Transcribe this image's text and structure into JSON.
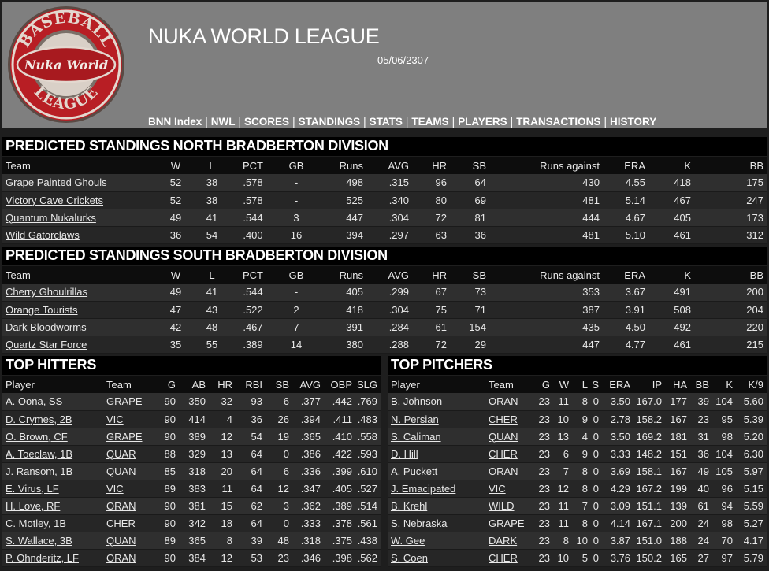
{
  "header": {
    "title": "NUKA WORLD LEAGUE",
    "date": "05/06/2307",
    "logo": {
      "top_text": "BASEBALL",
      "center_text": "Nuka World",
      "bottom_text": "LEAGUE",
      "colors": {
        "outer": "#b81e24",
        "inner": "#a81a1f",
        "ring": "#7a7068",
        "center": "#d9d0c7"
      }
    }
  },
  "nav": [
    {
      "label": "BNN Index"
    },
    {
      "label": "NWL"
    },
    {
      "label": "SCORES"
    },
    {
      "label": "STANDINGS"
    },
    {
      "label": "STATS"
    },
    {
      "label": "TEAMS"
    },
    {
      "label": "PLAYERS"
    },
    {
      "label": "TRANSACTIONS"
    },
    {
      "label": "HISTORY"
    }
  ],
  "north": {
    "title": "PREDICTED STANDINGS NORTH BRADBERTON DIVISION",
    "headers": [
      "Team",
      "W",
      "L",
      "PCT",
      "GB",
      "Runs",
      "AVG",
      "HR",
      "SB",
      "Runs against",
      "ERA",
      "K",
      "BB"
    ],
    "rows": [
      [
        "Grape Painted Ghouls",
        "52",
        "38",
        ".578",
        "-",
        "498",
        ".315",
        "96",
        "64",
        "430",
        "4.55",
        "418",
        "175"
      ],
      [
        "Victory Cave Crickets",
        "52",
        "38",
        ".578",
        "-",
        "525",
        ".340",
        "80",
        "69",
        "481",
        "5.14",
        "467",
        "247"
      ],
      [
        "Quantum Nukalurks",
        "49",
        "41",
        ".544",
        "3",
        "447",
        ".304",
        "72",
        "81",
        "444",
        "4.67",
        "405",
        "173"
      ],
      [
        "Wild Gatorclaws",
        "36",
        "54",
        ".400",
        "16",
        "394",
        ".297",
        "63",
        "36",
        "481",
        "5.10",
        "461",
        "312"
      ]
    ]
  },
  "south": {
    "title": "PREDICTED STANDINGS SOUTH BRADBERTON DIVISION",
    "headers": [
      "Team",
      "W",
      "L",
      "PCT",
      "GB",
      "Runs",
      "AVG",
      "HR",
      "SB",
      "Runs against",
      "ERA",
      "K",
      "BB"
    ],
    "rows": [
      [
        "Cherry Ghoulrillas",
        "49",
        "41",
        ".544",
        "-",
        "405",
        ".299",
        "67",
        "73",
        "353",
        "3.67",
        "491",
        "200"
      ],
      [
        "Orange Tourists",
        "47",
        "43",
        ".522",
        "2",
        "418",
        ".304",
        "75",
        "71",
        "387",
        "3.91",
        "508",
        "204"
      ],
      [
        "Dark Bloodworms",
        "42",
        "48",
        ".467",
        "7",
        "391",
        ".284",
        "61",
        "154",
        "435",
        "4.50",
        "492",
        "220"
      ],
      [
        "Quartz Star Force",
        "35",
        "55",
        ".389",
        "14",
        "380",
        ".288",
        "72",
        "29",
        "447",
        "4.77",
        "461",
        "215"
      ]
    ]
  },
  "hitters": {
    "title": "TOP HITTERS",
    "headers": [
      "Player",
      "Team",
      "G",
      "AB",
      "HR",
      "RBI",
      "SB",
      "AVG",
      "OBP",
      "SLG"
    ],
    "rows": [
      [
        "A. Oona, SS",
        "GRAPE",
        "90",
        "350",
        "32",
        "93",
        "6",
        ".377",
        ".442",
        ".769"
      ],
      [
        "D. Crymes, 2B",
        "VIC",
        "90",
        "414",
        "4",
        "36",
        "26",
        ".394",
        ".411",
        ".483"
      ],
      [
        "O. Brown, CF",
        "GRAPE",
        "90",
        "389",
        "12",
        "54",
        "19",
        ".365",
        ".410",
        ".558"
      ],
      [
        "A. Toeclaw, 1B",
        "QUAR",
        "88",
        "329",
        "13",
        "64",
        "0",
        ".386",
        ".422",
        ".593"
      ],
      [
        "J. Ransom, 1B",
        "QUAN",
        "85",
        "318",
        "20",
        "64",
        "6",
        ".336",
        ".399",
        ".610"
      ],
      [
        "E. Virus, LF",
        "VIC",
        "89",
        "383",
        "11",
        "64",
        "12",
        ".347",
        ".405",
        ".527"
      ],
      [
        "H. Love, RF",
        "ORAN",
        "90",
        "381",
        "15",
        "62",
        "3",
        ".362",
        ".389",
        ".514"
      ],
      [
        "C. Motley, 1B",
        "CHER",
        "90",
        "342",
        "18",
        "64",
        "0",
        ".333",
        ".378",
        ".561"
      ],
      [
        "S. Wallace, 3B",
        "QUAN",
        "89",
        "365",
        "8",
        "39",
        "48",
        ".318",
        ".375",
        ".438"
      ],
      [
        "P. Ohnderitz, LF",
        "ORAN",
        "90",
        "384",
        "12",
        "53",
        "23",
        ".346",
        ".398",
        ".562"
      ]
    ]
  },
  "pitchers": {
    "title": "TOP PITCHERS",
    "headers": [
      "Player",
      "Team",
      "G",
      "W",
      "L",
      "S",
      "ERA",
      "IP",
      "HA",
      "BB",
      "K",
      "K/9"
    ],
    "rows": [
      [
        "B. Johnson",
        "ORAN",
        "23",
        "11",
        "8",
        "0",
        "3.50",
        "167.0",
        "177",
        "39",
        "104",
        "5.60"
      ],
      [
        "N. Persian",
        "CHER",
        "23",
        "10",
        "9",
        "0",
        "2.78",
        "158.2",
        "167",
        "23",
        "95",
        "5.39"
      ],
      [
        "S. Caliman",
        "QUAN",
        "23",
        "13",
        "4",
        "0",
        "3.50",
        "169.2",
        "181",
        "31",
        "98",
        "5.20"
      ],
      [
        "D. Hill",
        "CHER",
        "23",
        "6",
        "9",
        "0",
        "3.33",
        "148.2",
        "151",
        "36",
        "104",
        "6.30"
      ],
      [
        "A. Puckett",
        "ORAN",
        "23",
        "7",
        "8",
        "0",
        "3.69",
        "158.1",
        "167",
        "49",
        "105",
        "5.97"
      ],
      [
        "J. Emacipated",
        "VIC",
        "23",
        "12",
        "8",
        "0",
        "4.29",
        "167.2",
        "199",
        "40",
        "96",
        "5.15"
      ],
      [
        "B. Krehl",
        "WILD",
        "23",
        "11",
        "7",
        "0",
        "3.09",
        "151.1",
        "139",
        "61",
        "94",
        "5.59"
      ],
      [
        "S. Nebraska",
        "GRAPE",
        "23",
        "11",
        "8",
        "0",
        "4.14",
        "167.1",
        "200",
        "24",
        "98",
        "5.27"
      ],
      [
        "W. Gee",
        "DARK",
        "23",
        "8",
        "10",
        "0",
        "3.87",
        "151.0",
        "188",
        "24",
        "70",
        "4.17"
      ],
      [
        "S. Coen",
        "CHER",
        "23",
        "10",
        "5",
        "0",
        "3.76",
        "150.2",
        "165",
        "27",
        "97",
        "5.79"
      ]
    ]
  }
}
